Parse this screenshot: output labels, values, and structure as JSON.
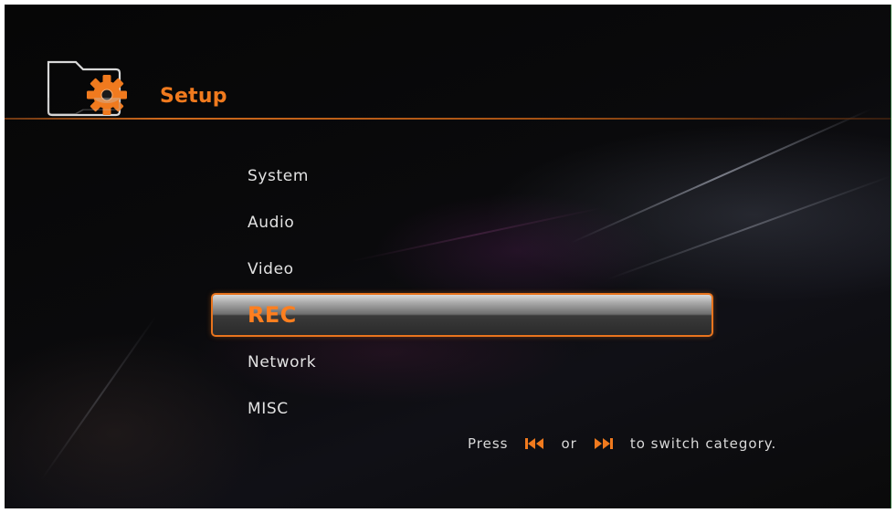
{
  "header": {
    "title": "Setup",
    "icon": "setup-folder-gear-icon"
  },
  "menu": {
    "items": [
      {
        "label": "System",
        "selected": false
      },
      {
        "label": "Audio",
        "selected": false
      },
      {
        "label": "Video",
        "selected": false
      },
      {
        "label": "REC",
        "selected": true
      },
      {
        "label": "Network",
        "selected": false
      },
      {
        "label": "MISC",
        "selected": false
      }
    ]
  },
  "hint": {
    "press": "Press",
    "or": "or",
    "suffix": "to switch category.",
    "prev_icon": "skip-previous-icon",
    "next_icon": "skip-next-icon"
  },
  "colors": {
    "accent": "#f07a1e",
    "text": "#e2e2e2",
    "background": "#0a0a0a"
  }
}
